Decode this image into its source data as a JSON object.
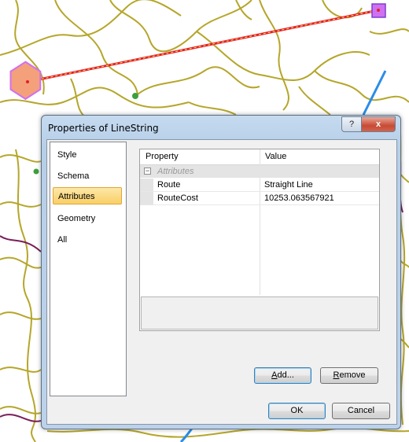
{
  "dialog": {
    "title": "Properties of LineString",
    "help_glyph": "?",
    "close_glyph": "x"
  },
  "nav": {
    "items": [
      {
        "label": "Style"
      },
      {
        "label": "Schema"
      },
      {
        "label": "Attributes"
      },
      {
        "label": "Geometry"
      },
      {
        "label": "All"
      }
    ],
    "selected": "Attributes"
  },
  "grid": {
    "columns": [
      "Property",
      "Value"
    ],
    "category": "Attributes",
    "expander_glyph": "−",
    "rows": [
      {
        "property": "Route",
        "value": "Straight Line"
      },
      {
        "property": "RouteCost",
        "value": "10253.063567921"
      }
    ]
  },
  "buttons": {
    "add": "Add...",
    "remove": "Remove",
    "ok": "OK",
    "cancel": "Cancel"
  },
  "colors": {
    "map_roads": "#b5a62a",
    "map_route": "#e0202a",
    "map_start_fill": "#f4a07a",
    "map_end_fill": "#d070f0",
    "river": "#2a8de8",
    "border": "#7a1f5a",
    "selection": "#f9cf67"
  }
}
